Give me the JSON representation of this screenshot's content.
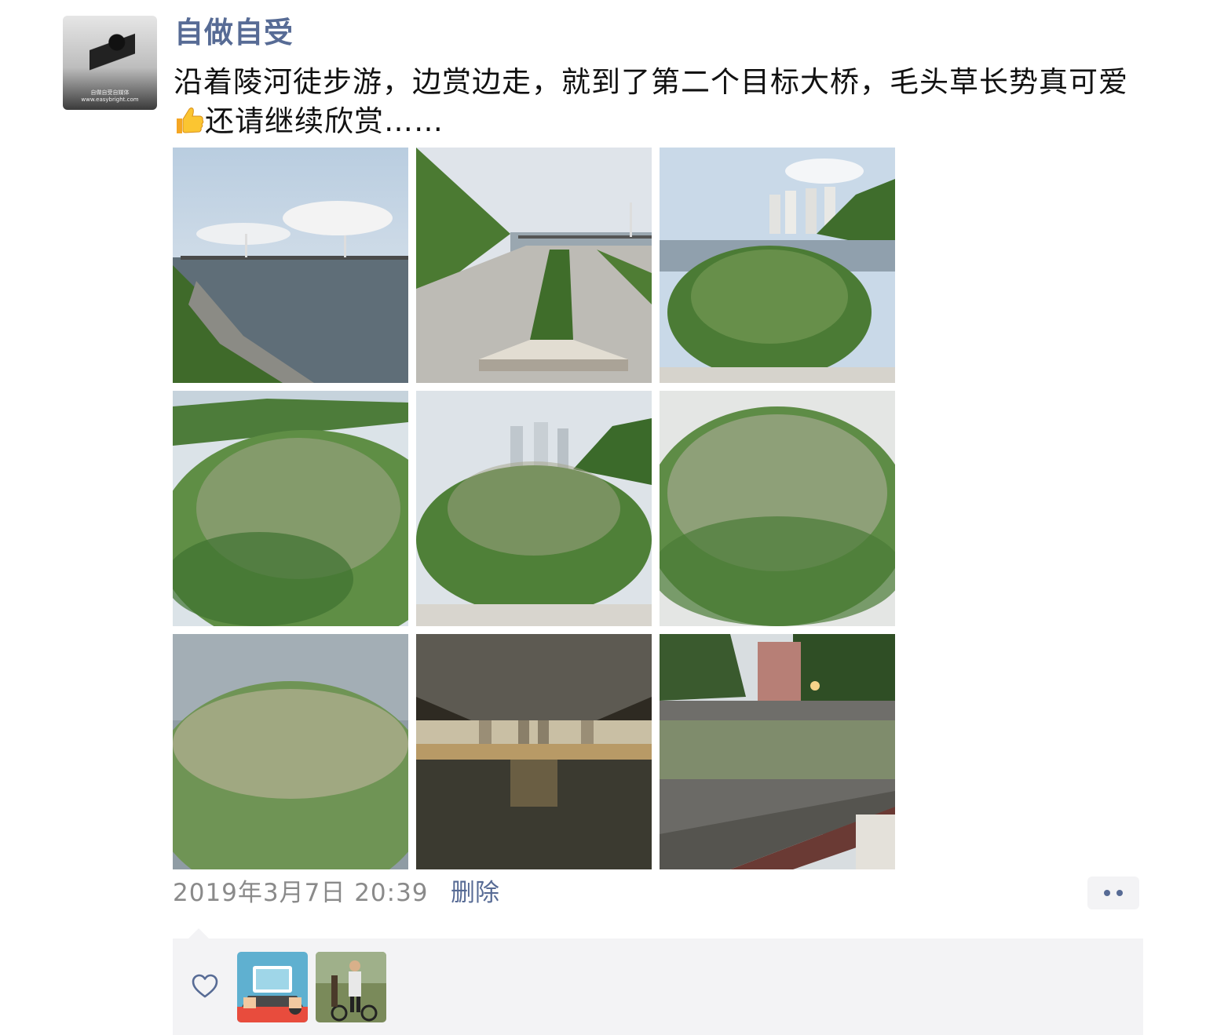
{
  "post": {
    "author": "自做自受",
    "avatar_watermark_1": "自做自受自媒体",
    "avatar_watermark_2": "www.easybright.com",
    "text_before_emoji": "沿着陵河徒步游，边赏边走，就到了第二个目标大桥，毛头草长势真可爱",
    "emoji": "thumbs-up-icon",
    "text_after_emoji": "还请继续欣赏……",
    "timestamp": "2019年3月7日 20:39",
    "delete_label": "删除",
    "photos": [
      "river-bridge-photo",
      "riverside-walkway-photo",
      "grass-clump-towers-photo",
      "grass-closeup-photo",
      "grass-clump-city-photo",
      "grass-plumes-photo",
      "grass-over-water-photo",
      "under-bridge-photo",
      "terrace-wall-photo"
    ]
  },
  "likes": {
    "icon": "heart-icon",
    "users": [
      "like-user-1",
      "like-user-2"
    ]
  },
  "colors": {
    "link": "#576b95",
    "timestamp": "#8a8a8a",
    "panel": "#f3f3f5"
  }
}
